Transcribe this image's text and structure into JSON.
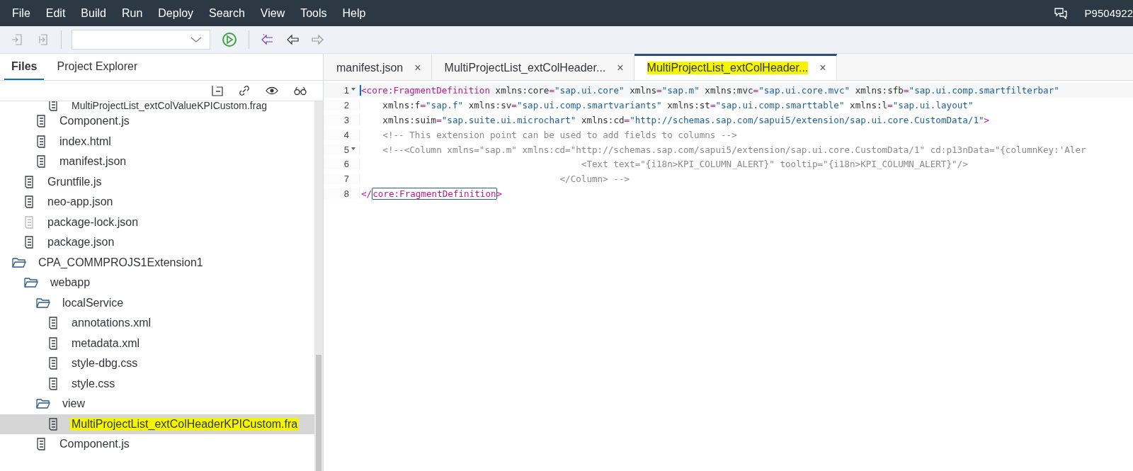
{
  "menu": [
    "File",
    "Edit",
    "Build",
    "Run",
    "Deploy",
    "Search",
    "View",
    "Tools",
    "Help"
  ],
  "user": "P9504922",
  "sidebar": {
    "tabs": [
      {
        "label": "Files",
        "selected": true
      },
      {
        "label": "Project Explorer",
        "selected": false
      }
    ],
    "tree": [
      {
        "kind": "group",
        "children": [
          {
            "kind": "group",
            "children": [
              {
                "kind": "group",
                "children": [
                  {
                    "kind": "file",
                    "label": "MultiProjectList_extColValueKPICustom.frag",
                    "selected": false,
                    "highlighted": false,
                    "dimmed": false
                  }
                ]
              },
              {
                "kind": "file",
                "label": "Component.js",
                "selected": false,
                "highlighted": false,
                "dimmed": false
              },
              {
                "kind": "file",
                "label": "index.html",
                "selected": false,
                "highlighted": false,
                "dimmed": false
              },
              {
                "kind": "file",
                "label": "manifest.json",
                "selected": false,
                "highlighted": false,
                "dimmed": false
              }
            ]
          },
          {
            "kind": "file",
            "label": "Gruntfile.js",
            "selected": false,
            "highlighted": false,
            "dimmed": false
          },
          {
            "kind": "file",
            "label": "neo-app.json",
            "selected": false,
            "highlighted": false,
            "dimmed": false
          },
          {
            "kind": "file",
            "label": "package-lock.json",
            "selected": false,
            "highlighted": false,
            "dimmed": true
          },
          {
            "kind": "file",
            "label": "package.json",
            "selected": false,
            "highlighted": false,
            "dimmed": false
          }
        ]
      },
      {
        "kind": "folder",
        "label": "CPA_COMMPROJS1Extension1",
        "expanded": true,
        "children": [
          {
            "kind": "folder",
            "label": "webapp",
            "expanded": true,
            "children": [
              {
                "kind": "folder",
                "label": "localService",
                "expanded": true,
                "children": [
                  {
                    "kind": "file",
                    "label": "annotations.xml",
                    "selected": false,
                    "highlighted": false,
                    "dimmed": false
                  },
                  {
                    "kind": "file",
                    "label": "metadata.xml",
                    "selected": false,
                    "highlighted": false,
                    "dimmed": false
                  },
                  {
                    "kind": "file",
                    "label": "style-dbg.css",
                    "selected": false,
                    "highlighted": false,
                    "dimmed": false
                  },
                  {
                    "kind": "file",
                    "label": "style.css",
                    "selected": false,
                    "highlighted": false,
                    "dimmed": false
                  }
                ]
              },
              {
                "kind": "folder",
                "label": "view",
                "expanded": true,
                "children": [
                  {
                    "kind": "file",
                    "label": "MultiProjectList_extColHeaderKPICustom.fra",
                    "selected": true,
                    "highlighted": true,
                    "dimmed": false
                  }
                ]
              },
              {
                "kind": "file",
                "label": "Component.js",
                "selected": false,
                "highlighted": false,
                "dimmed": false
              }
            ]
          }
        ]
      }
    ]
  },
  "editor": {
    "tabs": [
      {
        "label": "manifest.json",
        "selected": false,
        "highlighted": false,
        "close": "×"
      },
      {
        "label": "MultiProjectList_extColHeader...",
        "selected": false,
        "highlighted": false,
        "close": "×"
      },
      {
        "label": "MultiProjectList_extColHeader...",
        "selected": true,
        "highlighted": true,
        "close": "×"
      }
    ],
    "lines": [
      {
        "number": "1",
        "kind": "markup",
        "foldable": true,
        "current": true,
        "bracket_match": false,
        "text": "<core:FragmentDefinition xmlns:core=\"sap.ui.core\" xmlns=\"sap.m\" xmlns:mvc=\"sap.ui.core.mvc\" xmlns:sfb=\"sap.ui.comp.smartfilterbar\""
      },
      {
        "number": "2",
        "kind": "markup",
        "foldable": false,
        "current": false,
        "bracket_match": false,
        "text": "    xmlns:f=\"sap.f\" xmlns:sv=\"sap.ui.comp.smartvariants\" xmlns:st=\"sap.ui.comp.smarttable\" xmlns:l=\"sap.ui.layout\""
      },
      {
        "number": "3",
        "kind": "markup",
        "foldable": false,
        "current": false,
        "bracket_match": false,
        "text": "    xmlns:suim=\"sap.suite.ui.microchart\" xmlns:cd=\"http://schemas.sap.com/sapui5/extension/sap.ui.core.CustomData/1\">"
      },
      {
        "number": "4",
        "kind": "comment",
        "foldable": false,
        "current": false,
        "bracket_match": false,
        "text": "    <!-- This extension point can be used to add fields to columns -->"
      },
      {
        "number": "5",
        "kind": "comment",
        "foldable": true,
        "current": false,
        "bracket_match": false,
        "text": "    <!--<Column xmlns=\"sap.m\" xmlns:cd=\"http://schemas.sap.com/sapui5/extension/sap.ui.core.CustomData/1\" cd:p13nData=\"{columnKey:'Aler"
      },
      {
        "number": "6",
        "kind": "comment",
        "foldable": false,
        "current": false,
        "bracket_match": false,
        "text": "                                         <Text text=\"{i18n>KPI_COLUMN_ALERT}\" tooltip=\"{i18n>KPI_COLUMN_ALERT}\"/>"
      },
      {
        "number": "7",
        "kind": "comment",
        "foldable": false,
        "current": false,
        "bracket_match": false,
        "text": "                                     </Column> -->"
      },
      {
        "number": "8",
        "kind": "markup",
        "foldable": false,
        "current": false,
        "bracket_match": true,
        "text": "</core:FragmentDefinition>"
      }
    ]
  }
}
